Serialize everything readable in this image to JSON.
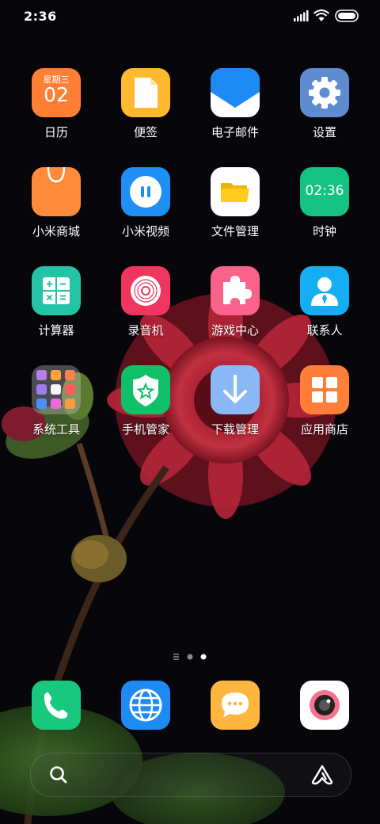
{
  "status_bar": {
    "time": "2:36"
  },
  "apps": {
    "calendar": {
      "label": "日历",
      "weekday": "星期三",
      "day": "02"
    },
    "notes": {
      "label": "便签"
    },
    "email": {
      "label": "电子邮件"
    },
    "settings": {
      "label": "设置"
    },
    "mi_store": {
      "label": "小米商城"
    },
    "mi_video": {
      "label": "小米视频"
    },
    "file_manager": {
      "label": "文件管理"
    },
    "clock": {
      "label": "时钟",
      "display": "02:36"
    },
    "calculator": {
      "label": "计算器"
    },
    "recorder": {
      "label": "录音机"
    },
    "game_center": {
      "label": "游戏中心"
    },
    "contacts": {
      "label": "联系人"
    },
    "system_tools": {
      "label": "系统工具"
    },
    "security": {
      "label": "手机管家"
    },
    "downloads": {
      "label": "下载管理"
    },
    "app_store": {
      "label": "应用商店"
    }
  },
  "page_indicator": {
    "pages": 3,
    "current": 3
  },
  "dock": [
    "phone",
    "browser",
    "messages",
    "camera"
  ],
  "colors": {
    "calendar": "#FF7F35",
    "notes": "#FFB92E",
    "settings": "#5F8CD0",
    "mi_store": "#FF8A3A",
    "mi_video": "#1E90F5",
    "clock": "#14C283",
    "calculator": "#25C3A6",
    "recorder": "#F0365F",
    "game_center": "#F9628A",
    "contacts": "#15AEF2",
    "security": "#10C068",
    "downloads": "#8AB7F5",
    "app_store": "#FF7E3A",
    "phone": "#18C87E",
    "browser": "#1E8BF5",
    "messages": "#FFB53E"
  }
}
